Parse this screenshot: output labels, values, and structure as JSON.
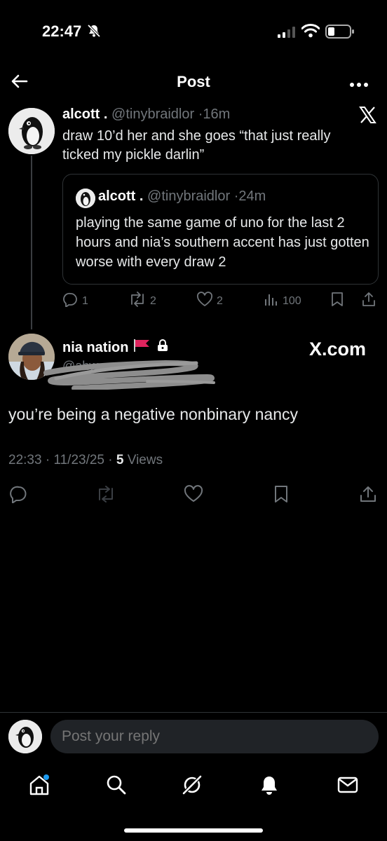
{
  "status_bar": {
    "time": "22:47",
    "icons": [
      "bell-slash-icon",
      "cellular-signal-icon",
      "wifi-icon",
      "battery-icon"
    ]
  },
  "nav": {
    "title": "Post",
    "back_icon": "arrow-left-icon",
    "more_icon": "more-horizontal-icon"
  },
  "tweet1": {
    "name": "alcott .",
    "handle": "@tinybraidlor",
    "time": "16m",
    "text": "draw 10’d her and she goes “that just really ticked my pickle darlin”",
    "quote": {
      "name": "alcott .",
      "handle": "@tinybraidlor",
      "time": "24m",
      "text": "playing the same game of uno for the last 2 hours and nia’s southern accent has just gotten worse with every draw 2"
    },
    "stats": {
      "replies": "1",
      "reposts": "2",
      "likes": "2",
      "views": "100"
    }
  },
  "tweet2": {
    "name": "nia nation",
    "handle": "@ahw",
    "text": "you’re being a negative nonbinary nancy",
    "time": "22:33",
    "date": "11/23/25",
    "views_count": "5",
    "views_label": "Views",
    "watermark": "X.com"
  },
  "reply": {
    "placeholder": "Post your reply"
  },
  "tabs": [
    "home-icon",
    "search-icon",
    "grok-icon",
    "notifications-icon",
    "messages-icon"
  ],
  "colors": {
    "background": "#000000",
    "muted": "#71767b",
    "accent": "#1d9bf0",
    "flag": "#e0245e"
  }
}
